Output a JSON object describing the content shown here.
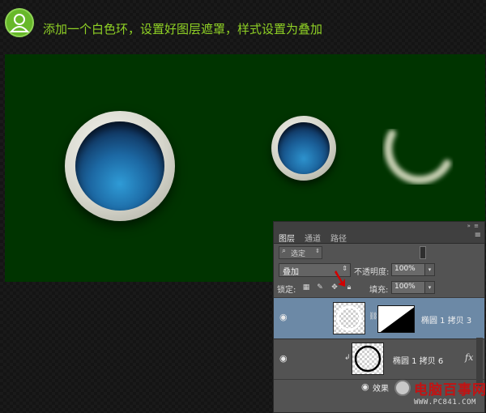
{
  "header": {
    "instruction": "添加一个白色环，设置好图层遮罩，样式设置为叠加"
  },
  "panel": {
    "tabs": [
      "图层",
      "通道",
      "路径"
    ],
    "filter": {
      "label": "选定"
    },
    "blend_mode": "叠加",
    "opacity_label": "不透明度:",
    "opacity_value": "100%",
    "lock_label": "锁定:",
    "fill_label": "填充:",
    "fill_value": "100%",
    "layers": [
      {
        "name": "椭圆 1 拷贝 3",
        "selected": true
      },
      {
        "name": "椭圆 1 拷贝 6",
        "fx": "fx"
      },
      {
        "name": "效果"
      }
    ]
  },
  "watermark": {
    "name": "电脑百事网",
    "url": "WWW.PC841.COM"
  },
  "colors": {
    "canvas_bg": "#003400",
    "instruction_text": "#8fd125",
    "selected_layer": "#6c89a6",
    "arrow": "#d10000"
  }
}
